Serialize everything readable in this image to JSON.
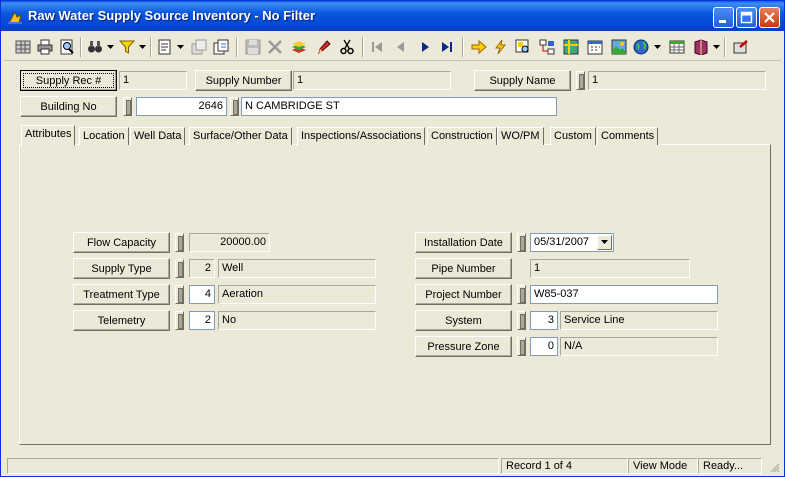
{
  "window": {
    "title": "Raw Water Supply Source Inventory - No Filter"
  },
  "colors": {
    "titlebar": "#0446d2",
    "face": "#ece9d8",
    "close_button": "#c43a12"
  },
  "toolbar": {
    "icons": [
      "grid-icon",
      "print-icon",
      "print-preview-icon",
      "binoculars-icon",
      "filter-icon",
      "new-record-icon",
      "copy-record-icon",
      "duplicate-icon",
      "save-icon",
      "delete-icon",
      "stack-icon",
      "edit-pencil-icon",
      "cut-icon",
      "first-record-icon",
      "previous-record-icon",
      "next-record-icon",
      "last-record-icon",
      "go-to-icon",
      "lightning-icon",
      "zoom-icon",
      "relations-icon",
      "map-icon",
      "calendar-icon",
      "image-icon",
      "globe-icon",
      "spreadsheet-icon",
      "book-icon",
      "exit-icon"
    ]
  },
  "header": {
    "supply_rec_label": "Supply Rec #",
    "supply_rec_value": "1",
    "supply_number_label": "Supply Number",
    "supply_number_value": "1",
    "supply_name_label": "Supply Name",
    "supply_name_value": "1",
    "building_no_label": "Building No",
    "building_number": "2646",
    "building_street": "N CAMBRIDGE ST"
  },
  "tabs": [
    {
      "label": "Attributes",
      "active": true
    },
    {
      "label": "Location"
    },
    {
      "label": "Well Data"
    },
    {
      "label": "Surface/Other Data"
    },
    {
      "label": "Inspections/Associations"
    },
    {
      "label": "Construction"
    },
    {
      "label": "WO/PM"
    },
    {
      "label": "Custom"
    },
    {
      "label": "Comments"
    }
  ],
  "attributes": {
    "flow_capacity_label": "Flow Capacity",
    "flow_capacity_value": "20000.00",
    "supply_type_label": "Supply Type",
    "supply_type_code": "2",
    "supply_type_value": "Well",
    "treatment_type_label": "Treatment Type",
    "treatment_type_code": "4",
    "treatment_type_value": "Aeration",
    "telemetry_label": "Telemetry",
    "telemetry_code": "2",
    "telemetry_value": "No",
    "installation_date_label": "Installation Date",
    "installation_date_value": "05/31/2007",
    "pipe_number_label": "Pipe Number",
    "pipe_number_value": "1",
    "project_number_label": "Project Number",
    "project_number_value": "W85-037",
    "system_label": "System",
    "system_code": "3",
    "system_value": "Service Line",
    "pressure_zone_label": "Pressure Zone",
    "pressure_zone_code": "0",
    "pressure_zone_value": "N/A"
  },
  "status": {
    "record": "Record 1 of 4",
    "mode": "View Mode",
    "state": "Ready..."
  }
}
